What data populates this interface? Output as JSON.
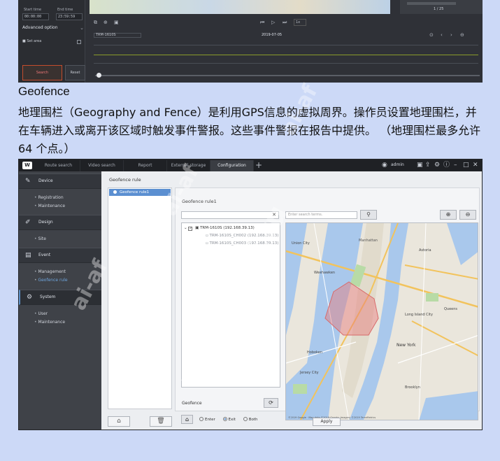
{
  "top_screenshot": {
    "start_time_label": "Start time",
    "end_time_label": "End time",
    "start_time": "00:00:00",
    "end_time": "23:59:59",
    "advanced_option": "Advanced option",
    "set_area": "Set area",
    "search_button": "Search",
    "reset_button": "Reset",
    "page": "1 / 25",
    "camera": "TRM-1610S",
    "date": "2019-07-05"
  },
  "text": {
    "heading": "Geofence",
    "description": "地理围栏（Geography and Fence）是利用GPS信息的虚拟周界。操作员设置地理围栏，并在车辆进入或离开该区域时触发事件警报。这些事件警报在报告中提供。 （地理围栏最多允许 64 个点。）"
  },
  "app": {
    "tabs": [
      "Route search",
      "Video search",
      "Report",
      "External storage",
      "Configuration"
    ],
    "active_tab": "Configuration",
    "user": "admin",
    "icons": {
      "logo": "W",
      "user": "user-icon",
      "lock": "lock-icon",
      "export": "export-icon",
      "settings": "gear-icon",
      "info": "info-icon",
      "minimize": "minimize-icon",
      "maximize": "maximize-icon",
      "close": "close-icon"
    },
    "sidebar": {
      "device": {
        "label": "Device",
        "items": [
          "Registration",
          "Maintenance"
        ]
      },
      "design": {
        "label": "Design",
        "items": [
          "Site"
        ]
      },
      "event": {
        "label": "Event",
        "items": [
          "Management",
          "Geofence rule"
        ]
      },
      "system": {
        "label": "System",
        "items": [
          "User",
          "Maintenance"
        ]
      }
    },
    "selected_sidebar_item": "Geofence rule",
    "panel_title": "Geofence rule",
    "rule_list": [
      "Geofence rule1"
    ],
    "editor": {
      "title": "Geofence rule1",
      "search_placeholder": "Enter search terms.",
      "tree_root": "TRM-1610S (192.168.39.13)",
      "tree_children": [
        "TRM-1610S_CH002 (192.168.39.13)",
        "TRM-1610S_CH003 (192.168.39.13)"
      ],
      "geofence_label": "Geofence",
      "radio_options": [
        "Enter",
        "Exit",
        "Both"
      ],
      "selected_radio": "Exit",
      "apply_button": "Apply",
      "map_credit": "©2019 Google · Map data ©2019 Google, Imagery ©2019 TerraMetrics",
      "map_labels": [
        "Union City",
        "Weehawken",
        "New York",
        "Manhattan",
        "Hoboken",
        "Jersey City",
        "Astoria",
        "Long Island City",
        "Queens",
        "Brooklyn"
      ]
    }
  },
  "watermark": "www.ai-af.ru",
  "watermark_short": "ai-af"
}
